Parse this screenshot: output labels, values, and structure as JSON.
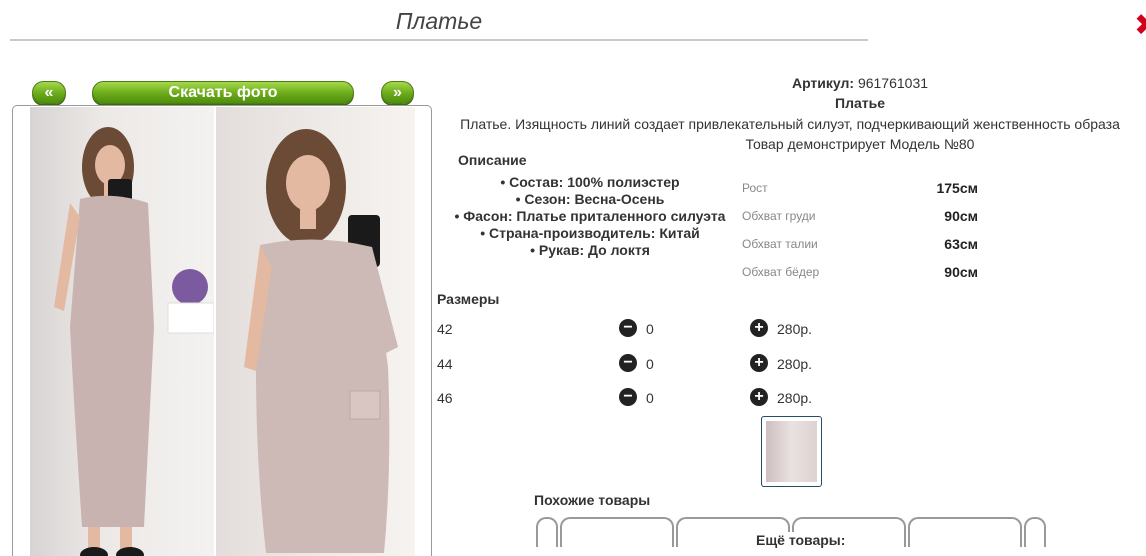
{
  "page": {
    "title": "Платье"
  },
  "gallery": {
    "prev_label": "«",
    "download_label": "Скачать фото",
    "next_label": "»"
  },
  "product": {
    "article_label": "Артикул:",
    "article_value": "961761031",
    "name": "Платье",
    "description": "Платье. Изящность линий создает привлекательный силуэт, подчеркивающий женственность образа",
    "model_note": "Товар демонстрирует Модель №80"
  },
  "details": {
    "heading": "Описание",
    "attributes": [
      "• Состав: 100% полиэстер",
      "• Сезон: Весна-Осень",
      "• Фасон: Платье приталенного силуэта",
      "• Страна-производитель: Китай",
      "• Рукав: До локтя"
    ]
  },
  "model_measurements": [
    {
      "label": "Рост",
      "value": "175см"
    },
    {
      "label": "Обхват груди",
      "value": "90см"
    },
    {
      "label": "Обхват талии",
      "value": "63см"
    },
    {
      "label": "Обхват бёдер",
      "value": "90см"
    }
  ],
  "sizes": {
    "heading": "Размеры",
    "rows": [
      {
        "size": "42",
        "qty": "0",
        "price": "280р."
      },
      {
        "size": "44",
        "qty": "0",
        "price": "280р."
      },
      {
        "size": "46",
        "qty": "0",
        "price": "280р."
      }
    ]
  },
  "similar": {
    "heading": "Похожие товары"
  },
  "more": {
    "heading": "Ещё товары:"
  },
  "icons": {
    "minus": "minus-circle-icon",
    "plus": "plus-circle-icon",
    "close": "close-icon"
  },
  "colors": {
    "accent_green": "#6aaa1a",
    "close_red": "#d0021b"
  }
}
